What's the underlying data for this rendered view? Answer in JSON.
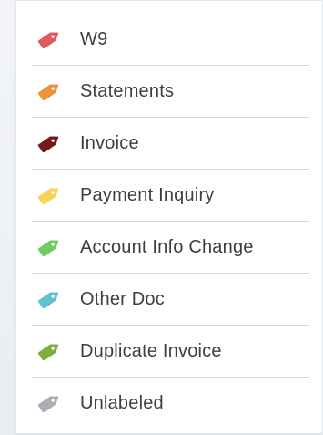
{
  "labels_menu": {
    "items": [
      {
        "label": "W9",
        "color": "#e05a5f",
        "icon": "tag-icon"
      },
      {
        "label": "Statements",
        "color": "#f0923c",
        "icon": "tag-icon"
      },
      {
        "label": "Invoice",
        "color": "#7a1620",
        "icon": "tag-icon"
      },
      {
        "label": "Payment Inquiry",
        "color": "#f7d358",
        "icon": "tag-icon"
      },
      {
        "label": "Account Info Change",
        "color": "#6dcc62",
        "icon": "tag-icon"
      },
      {
        "label": "Other Doc",
        "color": "#5ec4d0",
        "icon": "tag-icon"
      },
      {
        "label": "Duplicate Invoice",
        "color": "#7fae3a",
        "icon": "tag-icon"
      },
      {
        "label": "Unlabeled",
        "color": "#a9b0b5",
        "icon": "tag-icon"
      }
    ]
  }
}
